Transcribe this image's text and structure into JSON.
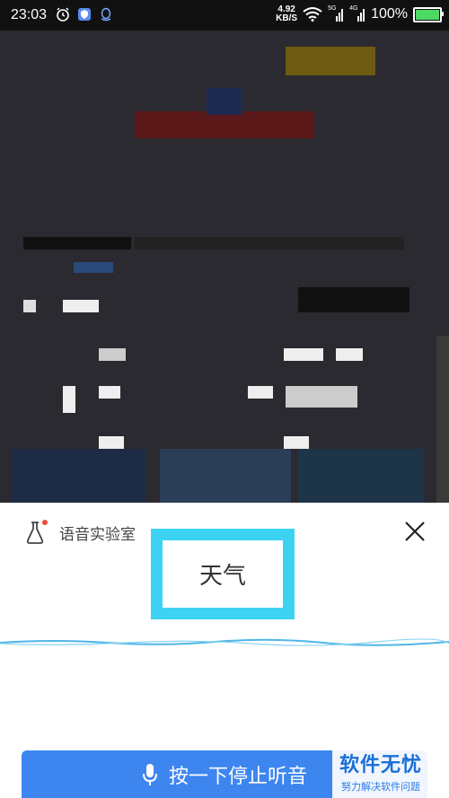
{
  "status_bar": {
    "time": "23:03",
    "net_speed_value": "4.92",
    "net_speed_unit": "KB/S",
    "battery": "100%",
    "signal_1": "5G",
    "signal_2": "4G"
  },
  "voice_panel": {
    "lab_label": "语音实验室",
    "query": "天气",
    "stop_button_label": "按一下停止听音"
  },
  "watermark": {
    "title": "软件无忧",
    "subtitle": "努力解决软件问题"
  },
  "colors": {
    "highlight_border": "#3cd3f2",
    "button_blue": "#3d86f0",
    "watermark_blue": "#1b6fd8"
  }
}
